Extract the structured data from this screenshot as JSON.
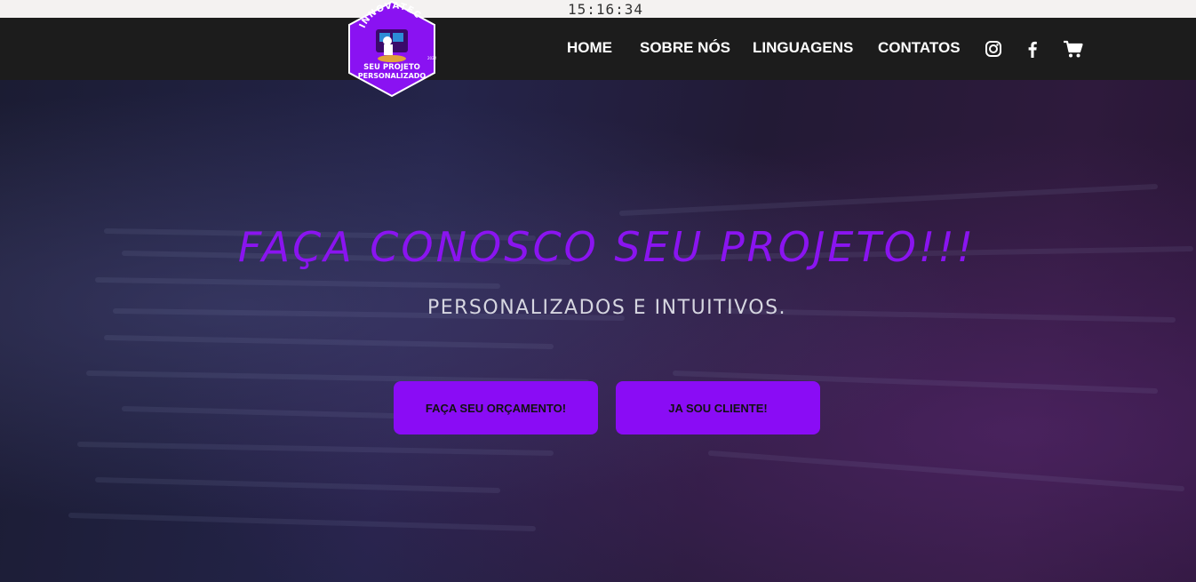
{
  "system": {
    "clock": "15:16:34"
  },
  "brand": {
    "logo_name": "INNOVATEC",
    "logo_tagline_1": "SEU PROJETO",
    "logo_tagline_2": "PERSONALIZADO",
    "logo_year": "2022"
  },
  "nav": {
    "items": [
      {
        "label": "HOME"
      },
      {
        "label": "SOBRE NÓS"
      },
      {
        "label": "LINGUAGENS"
      },
      {
        "label": "CONTATOS"
      }
    ],
    "icons": [
      "instagram-icon",
      "facebook-icon",
      "cart-icon"
    ]
  },
  "hero": {
    "title": "FAÇA CONOSCO SEU PROJETO!!!",
    "subtitle": "PERSONALIZADOS E INTUITIVOS.",
    "buttons": [
      {
        "label": "FAÇA SEU ORÇAMENTO!"
      },
      {
        "label": "JA SOU CLIENTE!"
      }
    ]
  },
  "colors": {
    "accent": "#8a0cf5",
    "navbar": "#1c1c1c",
    "topbar": "#f4f2f1"
  }
}
